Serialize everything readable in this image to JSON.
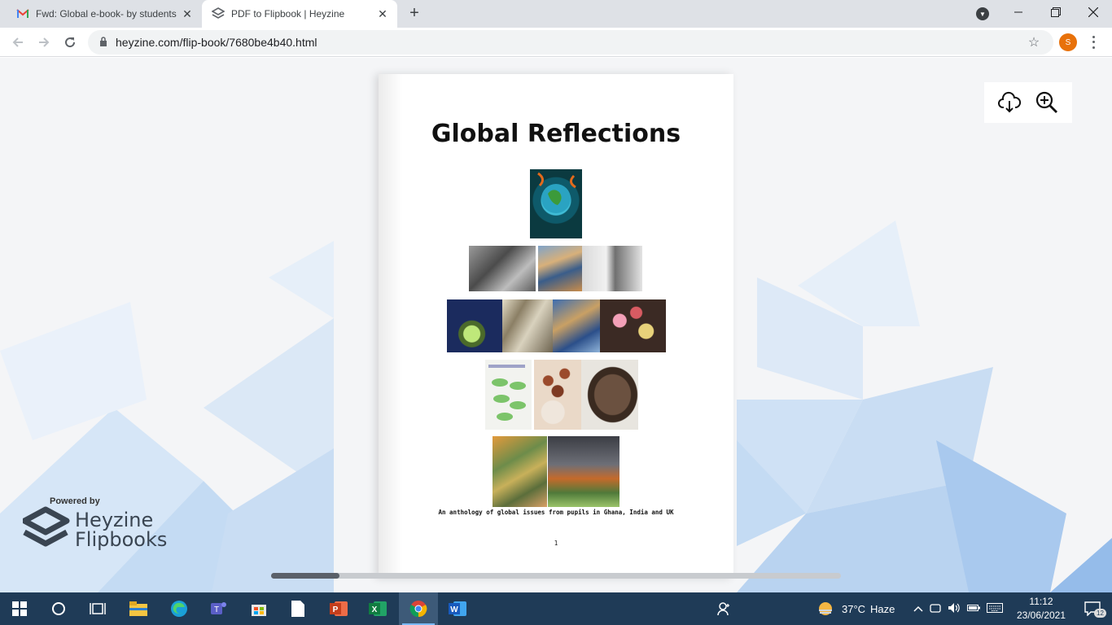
{
  "browser": {
    "tabs": [
      {
        "title": "Fwd: Global e-book- by students",
        "icon": "gmail-icon",
        "active": false
      },
      {
        "title": "PDF to Flipbook | Heyzine",
        "icon": "heyzine-icon",
        "active": true
      }
    ],
    "new_tab_label": "+",
    "url": "heyzine.com/flip-book/7680be4b40.html",
    "avatar_letter": "S",
    "colors": {
      "avatar": "#e8710a",
      "tabbar": "#dee1e6"
    }
  },
  "flipbook": {
    "title": "Global Reflections",
    "subtitle": "An anthology of global issues from pupils in Ghana, India and UK",
    "page_number": "1",
    "tools": [
      {
        "name": "download-icon",
        "label": "Download"
      },
      {
        "name": "zoom-in-icon",
        "label": "Zoom in"
      }
    ],
    "scroll_position": 0.12
  },
  "branding": {
    "powered_by": "Powered by",
    "name_line1": "Heyzine",
    "name_line2": "Flipbooks"
  },
  "taskbar": {
    "weather": {
      "temp": "37°C",
      "condition": "Haze"
    },
    "time": "11:12",
    "date": "23/06/2021",
    "teams_badge": "9+",
    "notifications_count": "12"
  }
}
